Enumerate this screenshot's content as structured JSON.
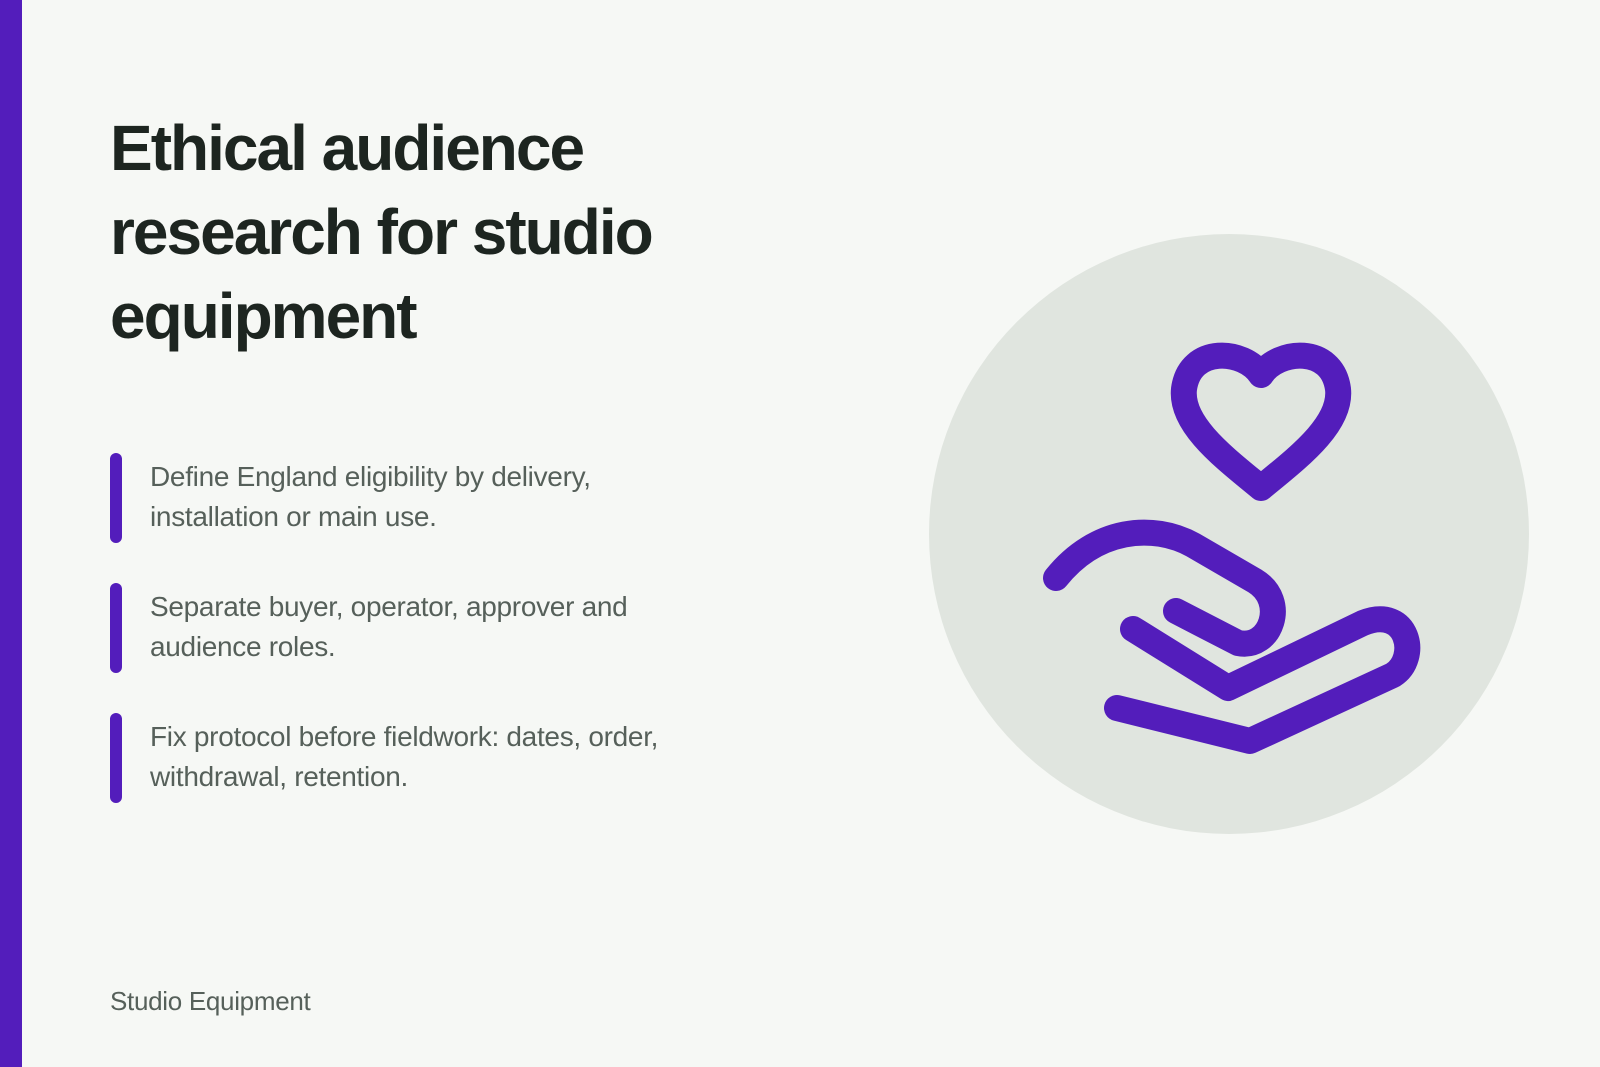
{
  "slide": {
    "title": "Ethical audience research for studio equipment",
    "points": [
      "Define England eligibility by delivery, installation or main use.",
      "Separate buyer, operator, approver and audience roles.",
      "Fix protocol before fieldwork: dates, order, withdrawal, retention."
    ],
    "footer": "Studio Equipment"
  },
  "illustration": {
    "icon": "hand-holding-heart-icon"
  },
  "colors": {
    "accent": "#531dbb",
    "background": "#f6f8f5",
    "circle": "#e0e5df",
    "title": "#1d2520",
    "body_text": "#56605a"
  }
}
